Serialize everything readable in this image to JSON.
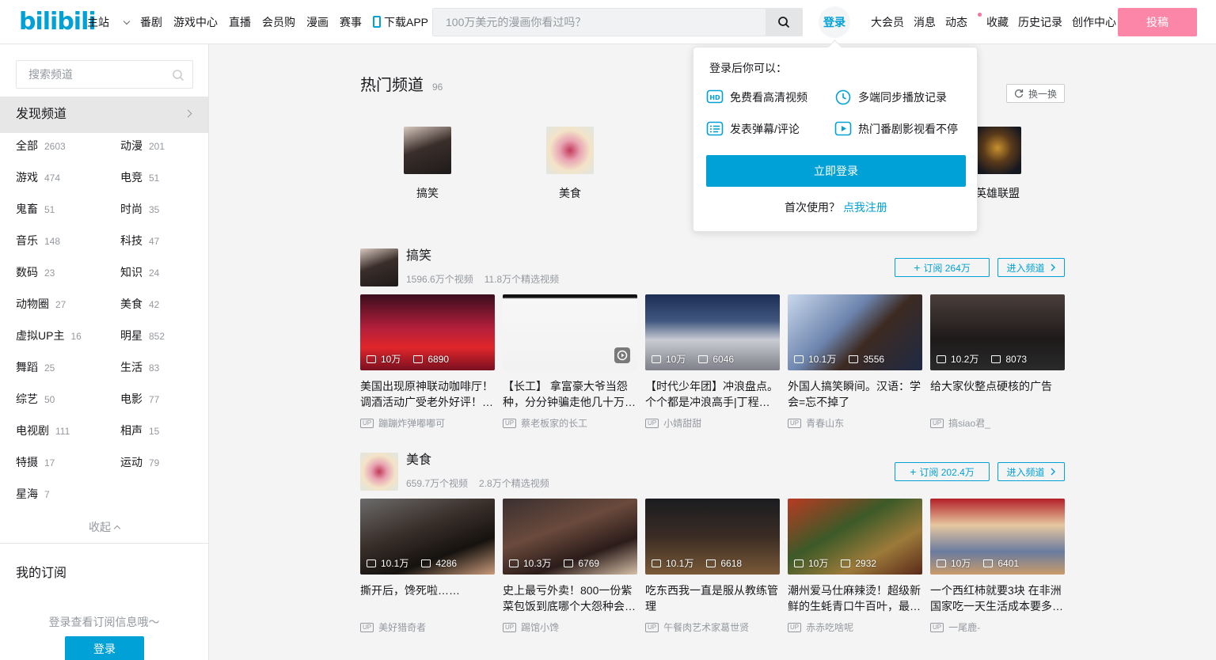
{
  "header": {
    "logo": "bilibili",
    "nav": [
      "主站",
      "番剧",
      "游戏中心",
      "直播",
      "会员购",
      "漫画",
      "赛事",
      "下载APP"
    ],
    "search_placeholder": "100万美元的漫画你看过吗？",
    "login": "登录",
    "right_nav": [
      "大会员",
      "消息",
      "动态",
      "收藏",
      "历史记录",
      "创作中心"
    ],
    "upload": "投稿"
  },
  "sidebar": {
    "search_placeholder": "搜索频道",
    "discover": "发现频道",
    "categories": [
      {
        "name": "全部",
        "count": "2603"
      },
      {
        "name": "动漫",
        "count": "201"
      },
      {
        "name": "游戏",
        "count": "474"
      },
      {
        "name": "电竞",
        "count": "51"
      },
      {
        "name": "鬼畜",
        "count": "51"
      },
      {
        "name": "时尚",
        "count": "35"
      },
      {
        "name": "音乐",
        "count": "148"
      },
      {
        "name": "科技",
        "count": "47"
      },
      {
        "name": "数码",
        "count": "23"
      },
      {
        "name": "知识",
        "count": "24"
      },
      {
        "name": "动物圈",
        "count": "27"
      },
      {
        "name": "美食",
        "count": "42"
      },
      {
        "name": "虚拟UP主",
        "count": "16"
      },
      {
        "name": "明星",
        "count": "852"
      },
      {
        "name": "舞蹈",
        "count": "25"
      },
      {
        "name": "生活",
        "count": "83"
      },
      {
        "name": "综艺",
        "count": "50"
      },
      {
        "name": "电影",
        "count": "77"
      },
      {
        "name": "电视剧",
        "count": "111"
      },
      {
        "name": "相声",
        "count": "15"
      },
      {
        "name": "特摄",
        "count": "17"
      },
      {
        "name": "运动",
        "count": "79"
      },
      {
        "name": "星海",
        "count": "7"
      }
    ],
    "collapse": "收起",
    "my_subscriptions": "我的订阅",
    "login_hint": "登录查看订阅信息哦～",
    "login_button": "登录"
  },
  "hot": {
    "title": "热门频道",
    "count": "96",
    "refresh": "换一换",
    "channels": [
      "搞笑",
      "美食",
      "英雄联盟"
    ]
  },
  "sections": [
    {
      "name": "搞笑",
      "videos_count": "1596.6万个视频",
      "featured_count": "11.8万个精选视频",
      "subscribe": "订阅 264万",
      "enter": "进入频道",
      "videos": [
        {
          "title": "美国出现原神联动咖啡厅！调酒活动广受老外好评！老外疯狂…",
          "plays": "10万",
          "likes": "6890",
          "up": "蹦蹦炸弹嘟嘟可"
        },
        {
          "title": "【长工】 拿富豪大爷当怨种，分分钟骗走他几十万…",
          "plays": "",
          "likes": "",
          "up": "蔡老板家的长工"
        },
        {
          "title": "【时代少年团】冲浪盘点。个个都是冲浪高手|丁程…",
          "plays": "10万",
          "likes": "6046",
          "up": "小婧甜甜"
        },
        {
          "title": "外国人搞笑瞬间。汉语：学会=忘不掉了",
          "plays": "10.1万",
          "likes": "3556",
          "up": "青春山东"
        },
        {
          "title": "给大家伙整点硬核的广告",
          "plays": "10.2万",
          "likes": "8073",
          "up": "搞siao君_"
        }
      ]
    },
    {
      "name": "美食",
      "videos_count": "659.7万个视频",
      "featured_count": "2.8万个精选视频",
      "subscribe": "订阅 202.4万",
      "enter": "进入频道",
      "videos": [
        {
          "title": "撕开后，馋死啦……",
          "plays": "10.1万",
          "likes": "4286",
          "up": "美好猎奇者"
        },
        {
          "title": "史上最亏外卖！800一份紫菜包饭到底哪个大怨种会…",
          "plays": "10.3万",
          "likes": "6769",
          "up": "踢馆小馋"
        },
        {
          "title": "吃东西我一直是服从教练管理",
          "plays": "10.1万",
          "likes": "6618",
          "up": "午餐肉艺术家葛世贤"
        },
        {
          "title": "潮州爱马仕麻辣烫！超级新鲜的生蚝青口牛百叶，最…",
          "plays": "10万",
          "likes": "2932",
          "up": "赤赤吃啥呢"
        },
        {
          "title": "一个西红柿就要3块 在非洲国家吃一天生活成本要多…",
          "plays": "10万",
          "likes": "6401",
          "up": "一尾鹿-"
        }
      ]
    }
  ],
  "popover": {
    "title": "登录后你可以：",
    "items": [
      "免费看高清视频",
      "多端同步播放记录",
      "发表弹幕/评论",
      "热门番剧影视看不停"
    ],
    "button": "立即登录",
    "register_prompt": "首次使用？",
    "register_link": "点我注册"
  },
  "colors": {
    "accent": "#00a1d6",
    "pink": "#fb7299"
  }
}
